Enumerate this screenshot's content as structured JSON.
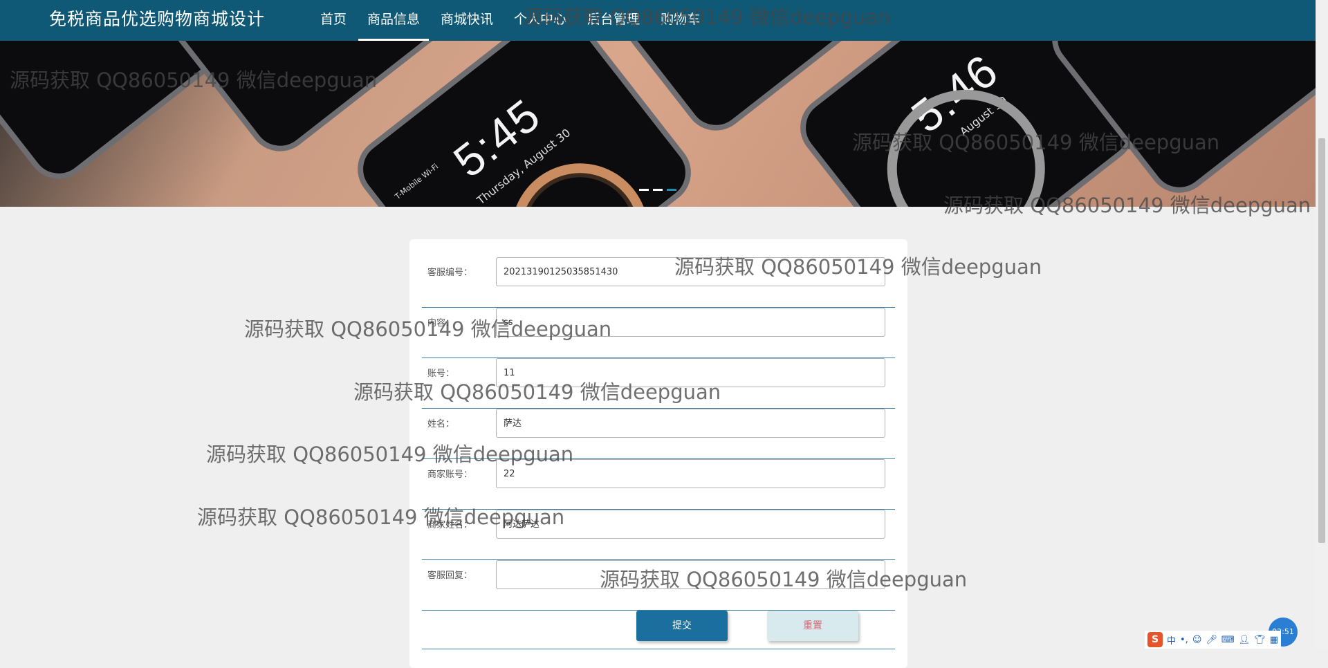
{
  "header": {
    "brand": "免税商品优选购物商城设计",
    "nav": [
      {
        "label": "首页"
      },
      {
        "label": "商品信息"
      },
      {
        "label": "商城快讯"
      },
      {
        "label": "个人中心"
      },
      {
        "label": "后台管理"
      },
      {
        "label": "购物车"
      }
    ]
  },
  "banner": {
    "phone1_time": "5:45",
    "phone1_date": "Thursday, August 30",
    "phone2_time": "5:46",
    "phone2_date": "August 30",
    "carrier": "T-Mobile Wi-Fi",
    "active_slide": 3,
    "slide_count": 3
  },
  "form": {
    "fields": [
      {
        "label": "客服编号：",
        "value": "20213190125035851430"
      },
      {
        "label": "内容：",
        "value": "ss"
      },
      {
        "label": "账号：",
        "value": "11"
      },
      {
        "label": "姓名：",
        "value": "萨达"
      },
      {
        "label": "商家账号：",
        "value": "22"
      },
      {
        "label": "商家姓名：",
        "value": "阿达萨达"
      },
      {
        "label": "客服回复：",
        "value": ""
      }
    ],
    "submit_label": "提交",
    "reset_label": "重置"
  },
  "watermark": "源码获取 QQ86050149 微信deepguan",
  "tray": {
    "clock": "02:51",
    "ime": "中",
    "logo": "S"
  }
}
